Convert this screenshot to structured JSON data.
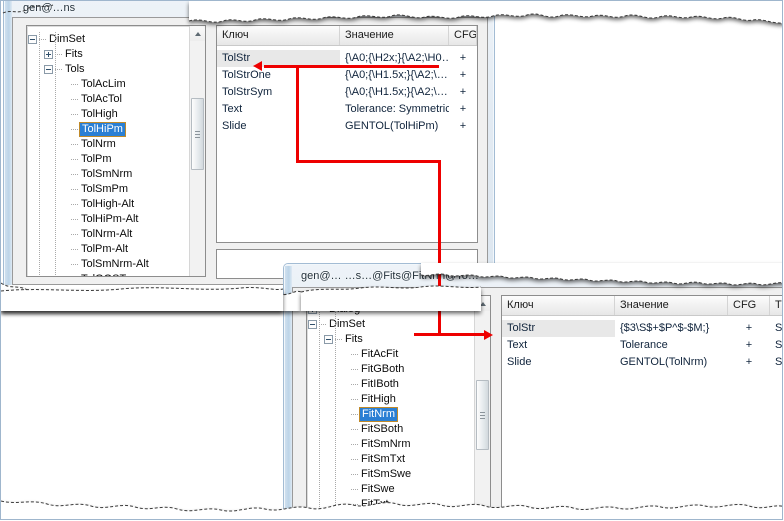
{
  "upper_window": {
    "title": "gen@…ns",
    "tree": {
      "items": [
        {
          "label": "DimSet",
          "depth": 0,
          "expander": "minus",
          "selected": false
        },
        {
          "label": "Fits",
          "depth": 1,
          "expander": "plus",
          "selected": false
        },
        {
          "label": "Tols",
          "depth": 1,
          "expander": "minus",
          "selected": false
        },
        {
          "label": "TolAcLim",
          "depth": 2,
          "expander": "none",
          "selected": false
        },
        {
          "label": "TolAcTol",
          "depth": 2,
          "expander": "none",
          "selected": false
        },
        {
          "label": "TolHigh",
          "depth": 2,
          "expander": "none",
          "selected": false
        },
        {
          "label": "TolHiPm",
          "depth": 2,
          "expander": "none",
          "selected": true
        },
        {
          "label": "TolNrm",
          "depth": 2,
          "expander": "none",
          "selected": false
        },
        {
          "label": "TolPm",
          "depth": 2,
          "expander": "none",
          "selected": false
        },
        {
          "label": "TolSmNrm",
          "depth": 2,
          "expander": "none",
          "selected": false
        },
        {
          "label": "TolSmPm",
          "depth": 2,
          "expander": "none",
          "selected": false
        },
        {
          "label": "TolHigh-Alt",
          "depth": 2,
          "expander": "none",
          "selected": false
        },
        {
          "label": "TolHiPm-Alt",
          "depth": 2,
          "expander": "none",
          "selected": false
        },
        {
          "label": "TolNrm-Alt",
          "depth": 2,
          "expander": "none",
          "selected": false
        },
        {
          "label": "TolPm-Alt",
          "depth": 2,
          "expander": "none",
          "selected": false
        },
        {
          "label": "TolSmNrm-Alt",
          "depth": 2,
          "expander": "none",
          "selected": false
        },
        {
          "label": "TolGOST",
          "depth": 2,
          "expander": "none",
          "selected": false
        }
      ]
    },
    "grid": {
      "columns": [
        "Ключ",
        "Значение",
        "CFG"
      ],
      "rows": [
        {
          "key": "TolStr",
          "value": "{\\A0;{\\H2x;}{\\A2;\\H0…",
          "cfg": "+",
          "key_selected": true
        },
        {
          "key": "TolStrOne",
          "value": "{\\A0;{\\H1.5x;}{\\A2;\\…",
          "cfg": "+",
          "key_selected": false
        },
        {
          "key": "TolStrSym",
          "value": "{\\A0;{\\H1.5x;}{\\A2;\\…",
          "cfg": "+",
          "key_selected": false
        },
        {
          "key": "Text",
          "value": "Tolerance: Symmetric…",
          "cfg": "+",
          "key_selected": false
        },
        {
          "key": "Slide",
          "value": "GENTOL(TolHiPm)",
          "cfg": "+",
          "key_selected": false
        }
      ]
    }
  },
  "lower_window": {
    "title": "gen@… …s…@Fits@FitNrm@To…",
    "tree": {
      "items": [
        {
          "label": "Dialog",
          "depth": 0,
          "expander": "plus",
          "selected": false
        },
        {
          "label": "DimSet",
          "depth": 0,
          "expander": "minus",
          "selected": false
        },
        {
          "label": "Fits",
          "depth": 1,
          "expander": "minus",
          "selected": false
        },
        {
          "label": "FitAcFit",
          "depth": 2,
          "expander": "none",
          "selected": false
        },
        {
          "label": "FitGBoth",
          "depth": 2,
          "expander": "none",
          "selected": false
        },
        {
          "label": "FitIBoth",
          "depth": 2,
          "expander": "none",
          "selected": false
        },
        {
          "label": "FitHigh",
          "depth": 2,
          "expander": "none",
          "selected": false
        },
        {
          "label": "FitNrm",
          "depth": 2,
          "expander": "none",
          "selected": true
        },
        {
          "label": "FitSBoth",
          "depth": 2,
          "expander": "none",
          "selected": false
        },
        {
          "label": "FitSmNrm",
          "depth": 2,
          "expander": "none",
          "selected": false
        },
        {
          "label": "FitSmTxt",
          "depth": 2,
          "expander": "none",
          "selected": false
        },
        {
          "label": "FitSmSwe",
          "depth": 2,
          "expander": "none",
          "selected": false
        },
        {
          "label": "FitSwe",
          "depth": 2,
          "expander": "none",
          "selected": false
        },
        {
          "label": "FitTxt",
          "depth": 2,
          "expander": "none",
          "selected": false
        }
      ]
    },
    "grid": {
      "columns": [
        "Ключ",
        "Значение",
        "CFG",
        "TY"
      ],
      "rows": [
        {
          "key": "TolStr",
          "value": "{$3\\S$+$P^$-$M;}",
          "cfg": "+",
          "type": "Str",
          "key_selected": true
        },
        {
          "key": "Text",
          "value": "Tolerance",
          "cfg": "+",
          "type": "Str",
          "key_selected": false
        },
        {
          "key": "Slide",
          "value": "GENTOL(TolNrm)",
          "cfg": "+",
          "type": "Str",
          "key_selected": false
        }
      ]
    }
  },
  "annotation": {
    "color": "#ee0000",
    "description": "red connector arrow from upper TolStr row to lower TolStr row"
  }
}
